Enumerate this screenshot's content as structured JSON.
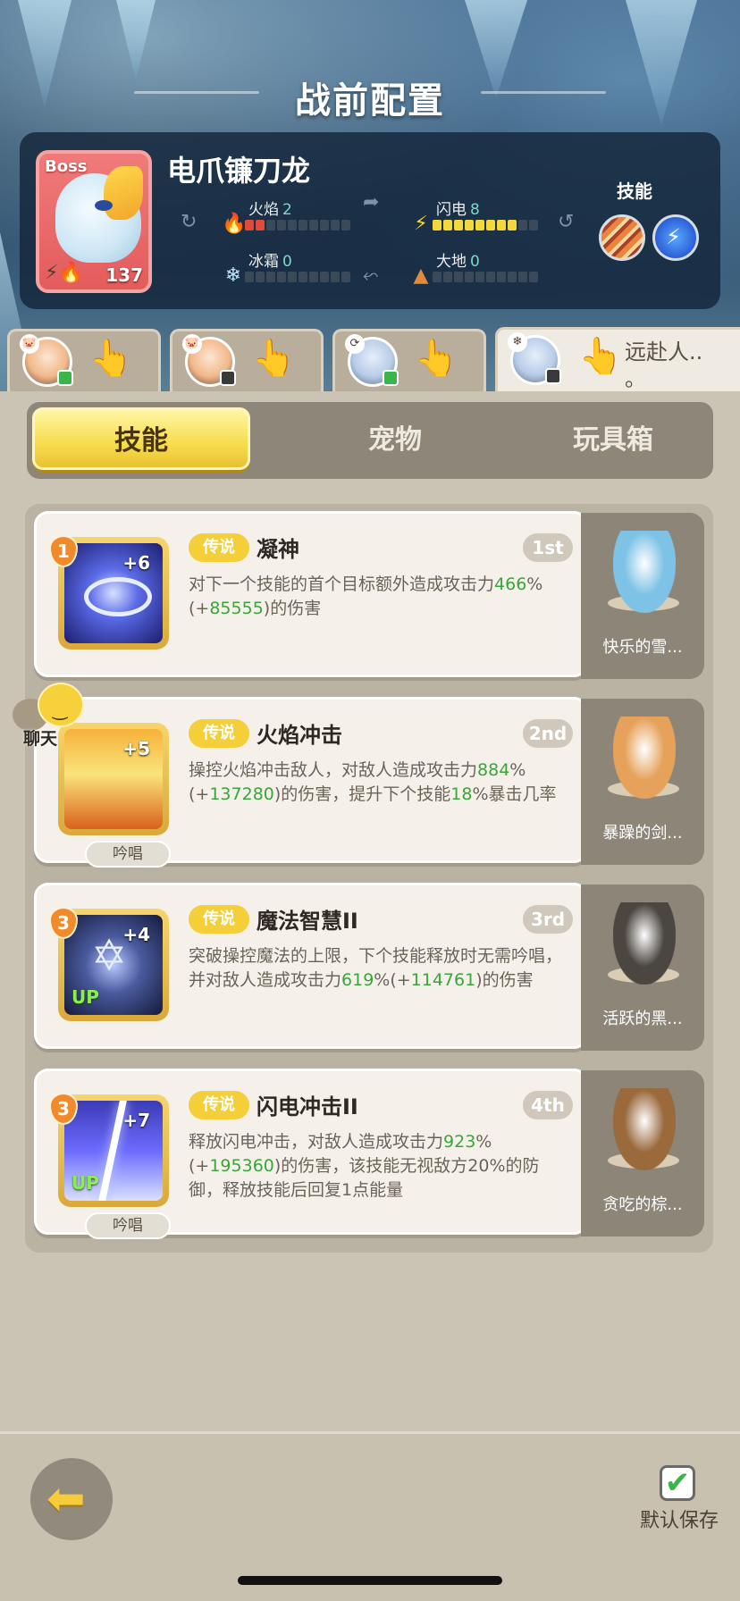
{
  "header": {
    "title": "战前配置"
  },
  "boss": {
    "tag": "Boss",
    "name": "电爪镰刀龙",
    "level": "137",
    "skills_label": "技能",
    "stats": [
      {
        "label": "火焰",
        "value": "2",
        "filled": 2,
        "icon": "flame-icon"
      },
      {
        "label": "闪电",
        "value": "8",
        "filled": 8,
        "icon": "lightning-icon"
      },
      {
        "label": "冰霜",
        "value": "0",
        "filled": 0,
        "icon": "snowflake-icon"
      },
      {
        "label": "大地",
        "value": "0",
        "filled": 0,
        "icon": "earth-icon"
      }
    ],
    "skills": [
      "fire-claw-skill-icon",
      "lightning-skill-icon"
    ]
  },
  "team_tabs": [
    {
      "label": "",
      "active": false
    },
    {
      "label": "",
      "active": false
    },
    {
      "label": "",
      "active": false
    },
    {
      "label": "远赴人..\n。",
      "active": true
    }
  ],
  "segments": [
    {
      "label": "技能",
      "active": true
    },
    {
      "label": "宠物",
      "active": false
    },
    {
      "label": "玩具箱",
      "active": false
    }
  ],
  "skills": [
    {
      "order": "1",
      "plus": "+6",
      "up": "",
      "chant": "",
      "rarity": "传说",
      "name": "凝神",
      "rank": "1st",
      "desc": [
        {
          "t": "对下一个技能的首个目标额外造成攻击力"
        },
        {
          "t": "466",
          "g": true
        },
        {
          "t": "%(+"
        },
        {
          "t": "85555",
          "g": true
        },
        {
          "t": ")的伤害"
        }
      ],
      "pet": {
        "name": "快乐的雪...",
        "color": "#7ec3e6"
      }
    },
    {
      "order": "",
      "plus": "+5",
      "up": "",
      "chant": "吟唱",
      "rarity": "传说",
      "name": "火焰冲击",
      "rank": "2nd",
      "desc": [
        {
          "t": "操控火焰冲击敌人，对敌人造成攻击力"
        },
        {
          "t": "884",
          "g": true
        },
        {
          "t": "%(+"
        },
        {
          "t": "137280",
          "g": true
        },
        {
          "t": ")的伤害，提升下个技能"
        },
        {
          "t": "18",
          "g": true
        },
        {
          "t": "%暴击几率"
        }
      ],
      "pet": {
        "name": "暴躁的剑...",
        "color": "#e6a25a"
      }
    },
    {
      "order": "3",
      "plus": "+4",
      "up": "UP",
      "chant": "",
      "rarity": "传说",
      "name": "魔法智慧II",
      "rank": "3rd",
      "desc": [
        {
          "t": "突破操控魔法的上限，下个技能释放时无需吟唱，并对敌人造成攻击力"
        },
        {
          "t": "619",
          "g": true
        },
        {
          "t": "%(+"
        },
        {
          "t": "114761",
          "g": true
        },
        {
          "t": ")的伤害"
        }
      ],
      "pet": {
        "name": "活跃的黑...",
        "color": "#4b4640"
      }
    },
    {
      "order": "3",
      "plus": "+7",
      "up": "UP",
      "chant": "吟唱",
      "rarity": "传说",
      "name": "闪电冲击II",
      "rank": "4th",
      "desc": [
        {
          "t": "释放闪电冲击，对敌人造成攻击力"
        },
        {
          "t": "923",
          "g": true
        },
        {
          "t": "%(+"
        },
        {
          "t": "195360",
          "g": true
        },
        {
          "t": ")的伤害，该技能无视敌方20%的防御，释放技能后回复1点能量"
        }
      ],
      "pet": {
        "name": "贪吃的棕...",
        "color": "#9a6a3c"
      }
    }
  ],
  "chat": {
    "label": "聊天"
  },
  "footer": {
    "save_label": "默认保存",
    "back_icon": "back-arrow-icon",
    "save_icon": "checkbox-icon"
  },
  "colors": {
    "accent_yellow": "#f7dc4c",
    "highlight_green": "#3aa53a",
    "rarity_gold": "#f4cf3a"
  }
}
